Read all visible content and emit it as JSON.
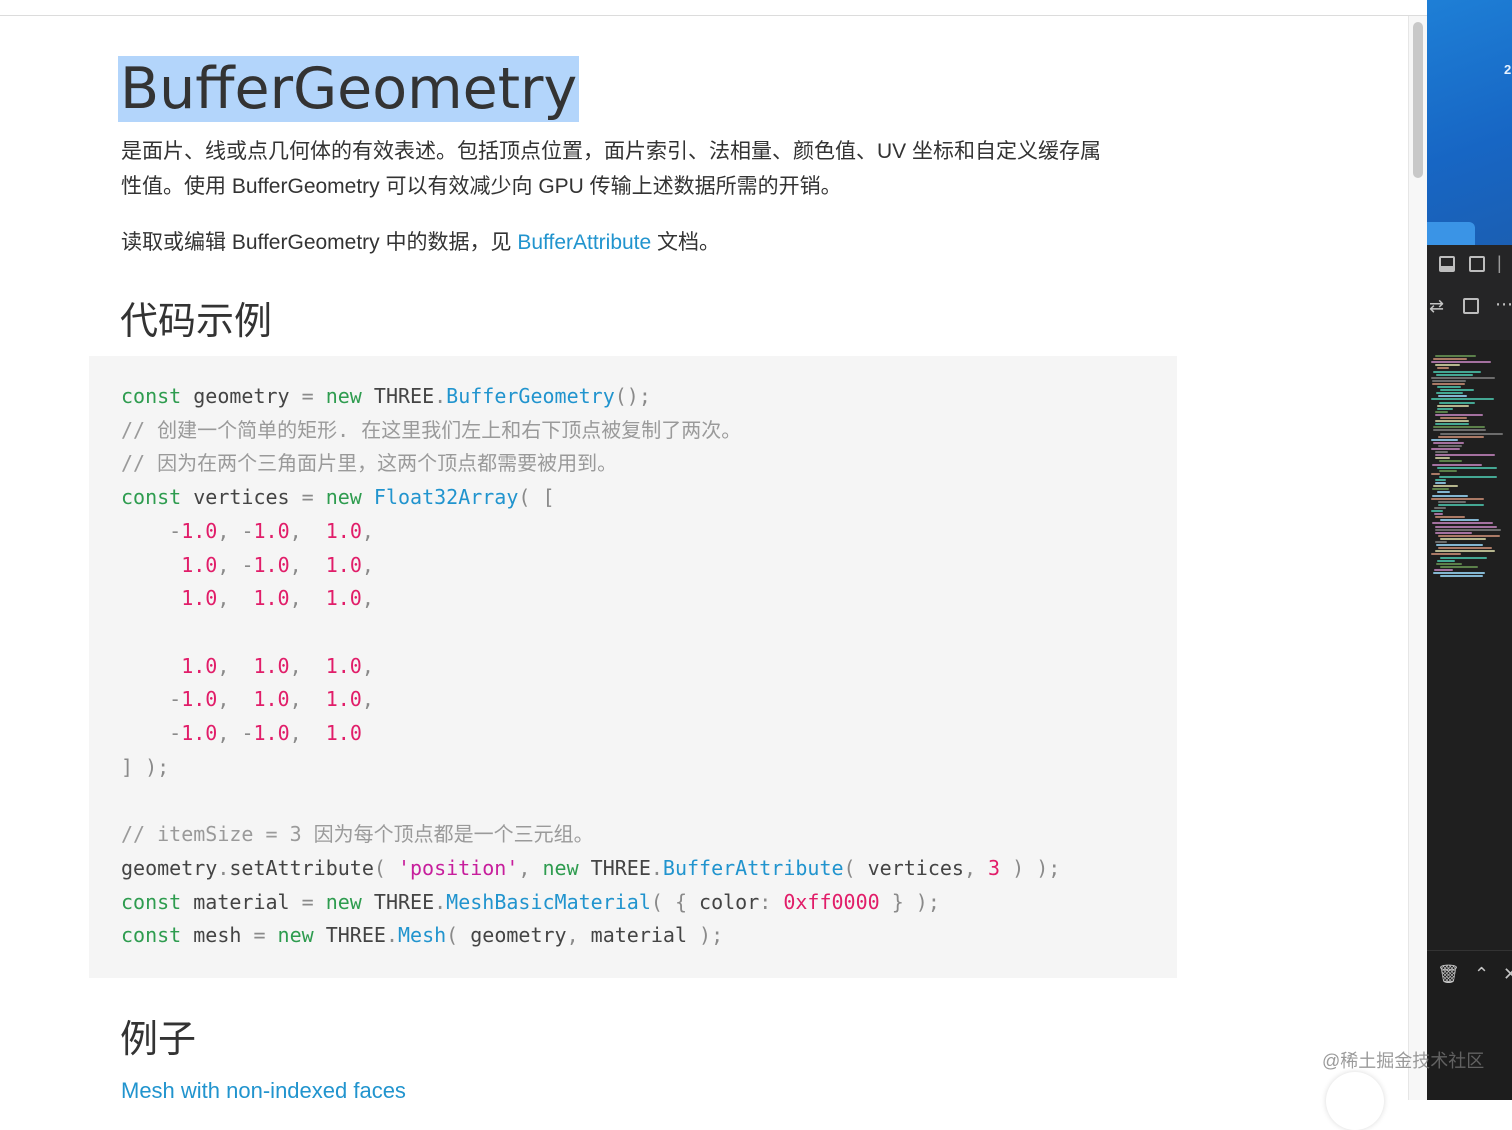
{
  "page": {
    "title": "BufferGeometry",
    "description": "是面片、线或点几何体的有效表述。包括顶点位置，面片索引、法相量、颜色值、UV 坐标和自定义缓存属性值。使用 BufferGeometry 可以有效减少向 GPU 传输上述数据所需的开销。",
    "read_edit": {
      "before": "读取或编辑 BufferGeometry 中的数据，见 ",
      "link": "BufferAttribute",
      "after": " 文档。"
    },
    "code_heading": "代码示例",
    "examples_heading": "例子",
    "example_link": "Mesh with non-indexed faces"
  },
  "code": {
    "c01_kw": "const",
    "c01_a": " geometry ",
    "c01_p": "=",
    "c01_kw2": " new",
    "c01_b": " THREE",
    "c01_p2": ".",
    "c01_fn": "BufferGeometry",
    "c01_p3": "();",
    "c02": "// 创建一个简单的矩形. 在这里我们左上和右下顶点被复制了两次。",
    "c03": "// 因为在两个三角面片里，这两个顶点都需要被用到。",
    "c04_kw": "const",
    "c04_a": " vertices ",
    "c04_p": "=",
    "c04_kw2": " new",
    "c04_fn": " Float32Array",
    "c04_p2": "( [",
    "v1": [
      "-",
      "1.0",
      ", ",
      "-",
      "1.0",
      ",  ",
      "1.0",
      ","
    ],
    "v2": [
      "1.0",
      ", ",
      "-",
      "1.0",
      ",  ",
      "1.0",
      ","
    ],
    "v3": [
      "1.0",
      ",  ",
      "1.0",
      ",  ",
      "1.0",
      ","
    ],
    "v4": [
      "1.0",
      ",  ",
      "1.0",
      ",  ",
      "1.0",
      ","
    ],
    "v5": [
      "-",
      "1.0",
      ",  ",
      "1.0",
      ",  ",
      "1.0",
      ","
    ],
    "v6": [
      "-",
      "1.0",
      ", ",
      "-",
      "1.0",
      ",  ",
      "1.0"
    ],
    "close": "] );",
    "c05": "// itemSize = 3 因为每个顶点都是一个三元组。",
    "c06_a": "geometry",
    "c06_p": ".",
    "c06_b": "setAttribute",
    "c06_p2": "( ",
    "c06_str": "'position'",
    "c06_p3": ", ",
    "c06_kw": "new",
    "c06_c": " THREE",
    "c06_p4": ".",
    "c06_fn": "BufferAttribute",
    "c06_p5": "( ",
    "c06_d": "vertices",
    "c06_p6": ", ",
    "c06_num": "3",
    "c06_p7": " ) );",
    "c07_kw": "const",
    "c07_a": " material ",
    "c07_p": "=",
    "c07_kw2": " new",
    "c07_b": " THREE",
    "c07_p2": ".",
    "c07_fn": "MeshBasicMaterial",
    "c07_p3": "( { ",
    "c07_c": "color",
    "c07_p4": ": ",
    "c07_num": "0xff0000",
    "c07_p5": " } );",
    "c08_kw": "const",
    "c08_a": " mesh ",
    "c08_p": "=",
    "c08_kw2": " new",
    "c08_b": " THREE",
    "c08_p2": ".",
    "c08_fn": "Mesh",
    "c08_p3": "( ",
    "c08_c": "geometry",
    "c08_p4": ", ",
    "c08_d": "material",
    "c08_p5": " );"
  },
  "side": {
    "digit": "2",
    "watermark": "@稀土掘金技术社区"
  },
  "colors": {
    "keyword": "#2e9c4f",
    "function": "#2194ce",
    "number": "#e11d69",
    "string": "#c71e9c",
    "comment": "#9a9a9a",
    "title_highlight": "#b3d5fb"
  },
  "icons": [
    "panel-bottom-icon",
    "split-editor-icon",
    "source-control-icon",
    "more-icon",
    "trash-icon",
    "chevron-up-icon",
    "close-icon"
  ]
}
